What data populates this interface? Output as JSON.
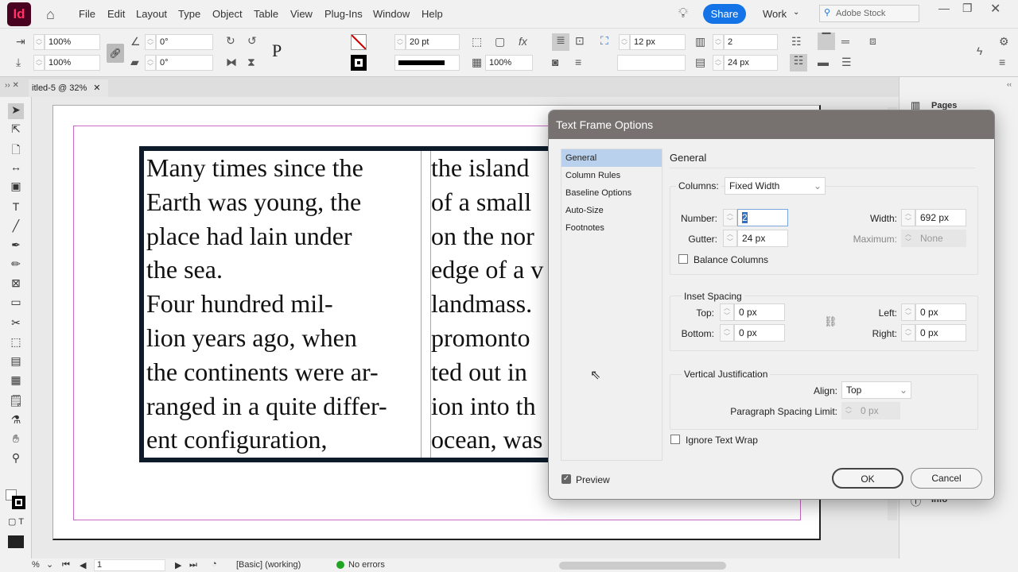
{
  "app": {
    "logo": "Id",
    "menus": [
      "File",
      "Edit",
      "Layout",
      "Type",
      "Object",
      "Table",
      "View",
      "Plug-Ins",
      "Window",
      "Help"
    ],
    "share": "Share",
    "workspace": "Work",
    "stock_placeholder": "Adobe Stock"
  },
  "control": {
    "scale_x": "100%",
    "scale_y": "100%",
    "rotate": "0°",
    "shear": "0°",
    "stroke_weight": "20 pt",
    "opacity": "100%",
    "inset": "12 px",
    "columns": "2",
    "gutter": "24 px",
    "p_glyph": "P"
  },
  "document": {
    "tab": "itled-5 @ 32%",
    "col1": [
      "Many times since the",
      "Earth was young, the",
      "place had lain under",
      "the sea.",
      "Four hundred mil-",
      "lion years ago, when",
      "the continents were ar-",
      "ranged in a quite differ-",
      "ent configuration,"
    ],
    "col2": [
      "the island",
      "of a small",
      "on the nor",
      "edge of a v",
      "landmass.",
      "promonto",
      "ted out in",
      "ion into th",
      "ocean, was"
    ]
  },
  "right_panel": {
    "pages": "Pages",
    "info": "Info"
  },
  "status": {
    "zoom": "%",
    "page": "1",
    "style": "[Basic] (working)",
    "errors": "No errors",
    "error_color": "#1fa51f"
  },
  "dialog": {
    "title": "Text Frame Options",
    "nav": [
      "General",
      "Column Rules",
      "Baseline Options",
      "Auto-Size",
      "Footnotes"
    ],
    "section": "General",
    "columns_label": "Columns:",
    "columns_value": "Fixed Width",
    "number_label": "Number:",
    "number_value": "2",
    "width_label": "Width:",
    "width_value": "692 px",
    "gutter_label": "Gutter:",
    "gutter_value": "24 px",
    "maximum_label": "Maximum:",
    "maximum_value": "None",
    "balance": "Balance Columns",
    "inset_title": "Inset Spacing",
    "top_label": "Top:",
    "top_value": "0 px",
    "bottom_label": "Bottom:",
    "bottom_value": "0 px",
    "left_label": "Left:",
    "left_value": "0 px",
    "right_label": "Right:",
    "right_value": "0 px",
    "vj_title": "Vertical Justification",
    "align_label": "Align:",
    "align_value": "Top",
    "psl_label": "Paragraph Spacing Limit:",
    "psl_value": "0 px",
    "ignore_wrap": "Ignore Text Wrap",
    "preview": "Preview",
    "preview_checked": true,
    "ok": "OK",
    "cancel": "Cancel"
  }
}
